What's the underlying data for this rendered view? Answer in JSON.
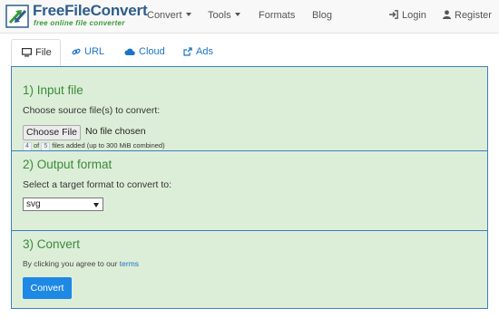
{
  "brand": {
    "name": "FreeFileConvert",
    "tagline": "free online file converter"
  },
  "nav": {
    "convert": "Convert",
    "tools": "Tools",
    "formats": "Formats",
    "blog": "Blog",
    "login": "Login",
    "register": "Register"
  },
  "tabs": [
    {
      "label": "File",
      "icon": "monitor-icon",
      "active": true
    },
    {
      "label": "URL",
      "icon": "link-icon",
      "active": false
    },
    {
      "label": "Cloud",
      "icon": "cloud-icon",
      "active": false
    },
    {
      "label": "Ads",
      "icon": "external-link-icon",
      "active": false
    }
  ],
  "input": {
    "title": "1) Input file",
    "label": "Choose source file(s) to convert:",
    "choose_button": "Choose File",
    "no_file": "No file chosen",
    "count_current": "4",
    "count_of": "of",
    "count_max": "5",
    "count_note": "files added (up to 300 MiB combined)"
  },
  "output": {
    "title": "2) Output format",
    "label": "Select a target format to convert to:",
    "selected_format": "svg"
  },
  "convert": {
    "title": "3) Convert",
    "agree_text": "By clicking you agree to our",
    "terms_link": "terms",
    "button": "Convert"
  },
  "colors": {
    "panel_bg": "#ddeed8",
    "panel_border": "#3b7fc4",
    "section_title": "#3a8a3a",
    "link": "#1a73c8",
    "button": "#1e88e5"
  }
}
